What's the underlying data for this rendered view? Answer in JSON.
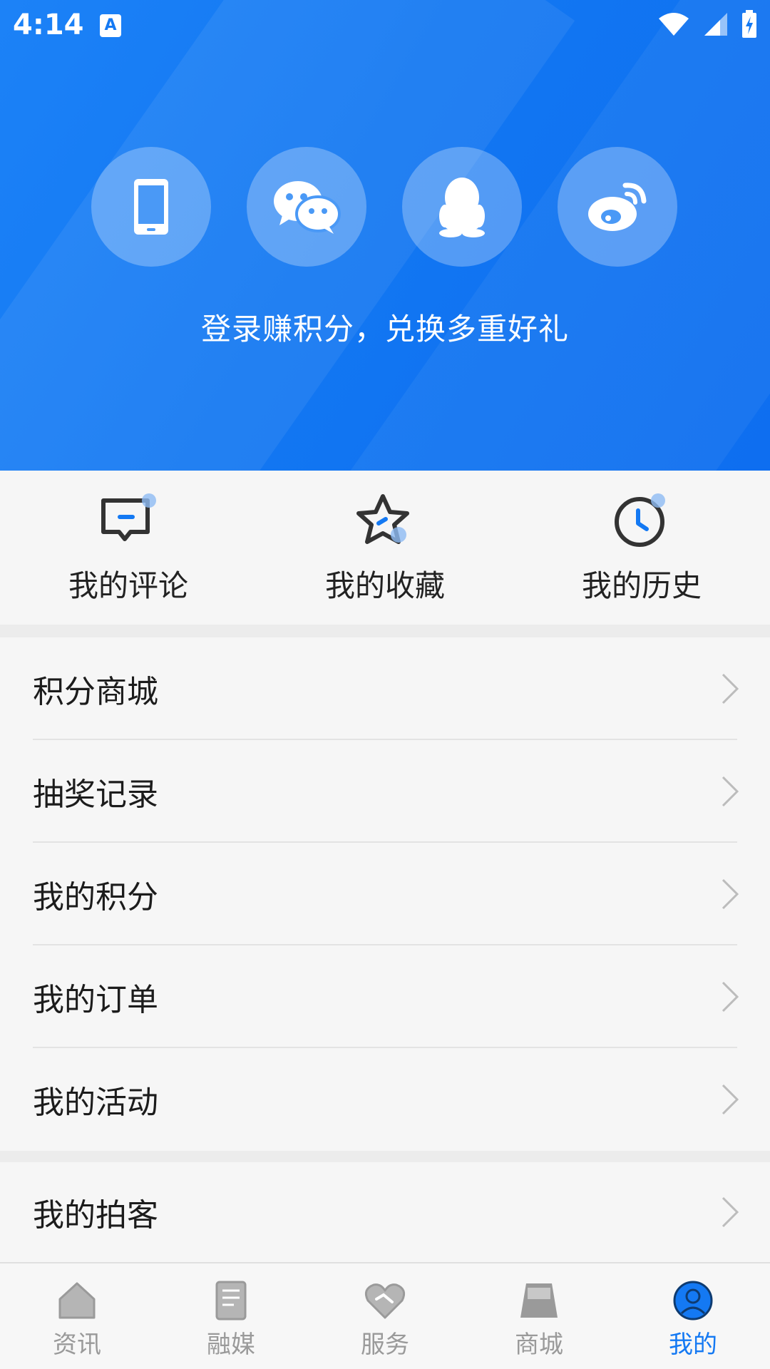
{
  "status_bar": {
    "time": "4:14",
    "notif_glyph": "A"
  },
  "header": {
    "login_buttons": [
      {
        "icon": "phone-icon"
      },
      {
        "icon": "wechat-icon"
      },
      {
        "icon": "qq-icon"
      },
      {
        "icon": "weibo-icon"
      }
    ],
    "tip": "登录赚积分，兑换多重好礼"
  },
  "quick_actions": [
    {
      "label": "我的评论",
      "icon": "comment-icon"
    },
    {
      "label": "我的收藏",
      "icon": "star-icon"
    },
    {
      "label": "我的历史",
      "icon": "clock-icon"
    }
  ],
  "menu": [
    {
      "label": "积分商城"
    },
    {
      "label": "抽奖记录"
    },
    {
      "label": "我的积分"
    },
    {
      "label": "我的订单"
    },
    {
      "label": "我的活动"
    }
  ],
  "menu2": [
    {
      "label": "我的拍客"
    }
  ],
  "tabs": [
    {
      "label": "资讯",
      "icon": "home-icon"
    },
    {
      "label": "融媒",
      "icon": "document-icon"
    },
    {
      "label": "服务",
      "icon": "heart-icon"
    },
    {
      "label": "商城",
      "icon": "shop-icon"
    },
    {
      "label": "我的",
      "icon": "profile-icon",
      "active": true
    }
  ],
  "colors": {
    "accent": "#1479f3",
    "header": "#1277f2"
  }
}
